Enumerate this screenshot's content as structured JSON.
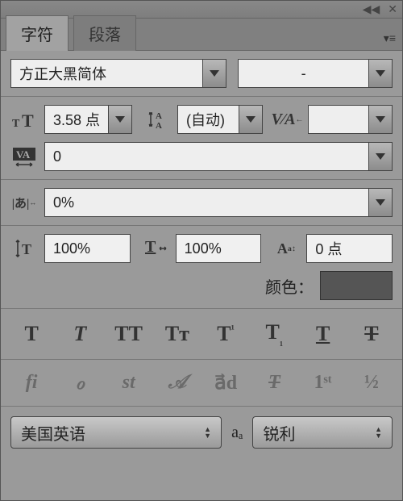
{
  "titlebar": {
    "collapse": "◀◀",
    "close": "✕"
  },
  "tabs": {
    "active": "字符",
    "inactive": "段落",
    "menu": "▾≡"
  },
  "font": {
    "family": "方正大黑简体",
    "style": "-"
  },
  "size": {
    "label_icon": "size",
    "value": "3.58 点"
  },
  "leading": {
    "value": "(自动)"
  },
  "kerning": {
    "value": ""
  },
  "tracking": {
    "value": "0"
  },
  "tsume": {
    "value": "0%"
  },
  "vscale": {
    "value": "100%"
  },
  "hscale": {
    "value": "100%"
  },
  "baseline": {
    "value": "0 点"
  },
  "color": {
    "label": "颜色：",
    "value": "#555555"
  },
  "styles": {
    "bold": "T",
    "italic": "T",
    "allcaps": "TT",
    "smallcaps": "Tᴛ",
    "super": "T",
    "sub": "T",
    "underline": "T",
    "strike": "T"
  },
  "opentype": {
    "liga": "fi",
    "swash": "ℴ",
    "stylistic": "st",
    "scriptA": "𝒜",
    "ordinals_arrow": "a⃗d",
    "titling": "T",
    "ordinal_1st": "1ˢᵗ",
    "frac": "½"
  },
  "language": {
    "value": "美国英语"
  },
  "aa": {
    "label": "aₐ",
    "value": "锐利"
  }
}
